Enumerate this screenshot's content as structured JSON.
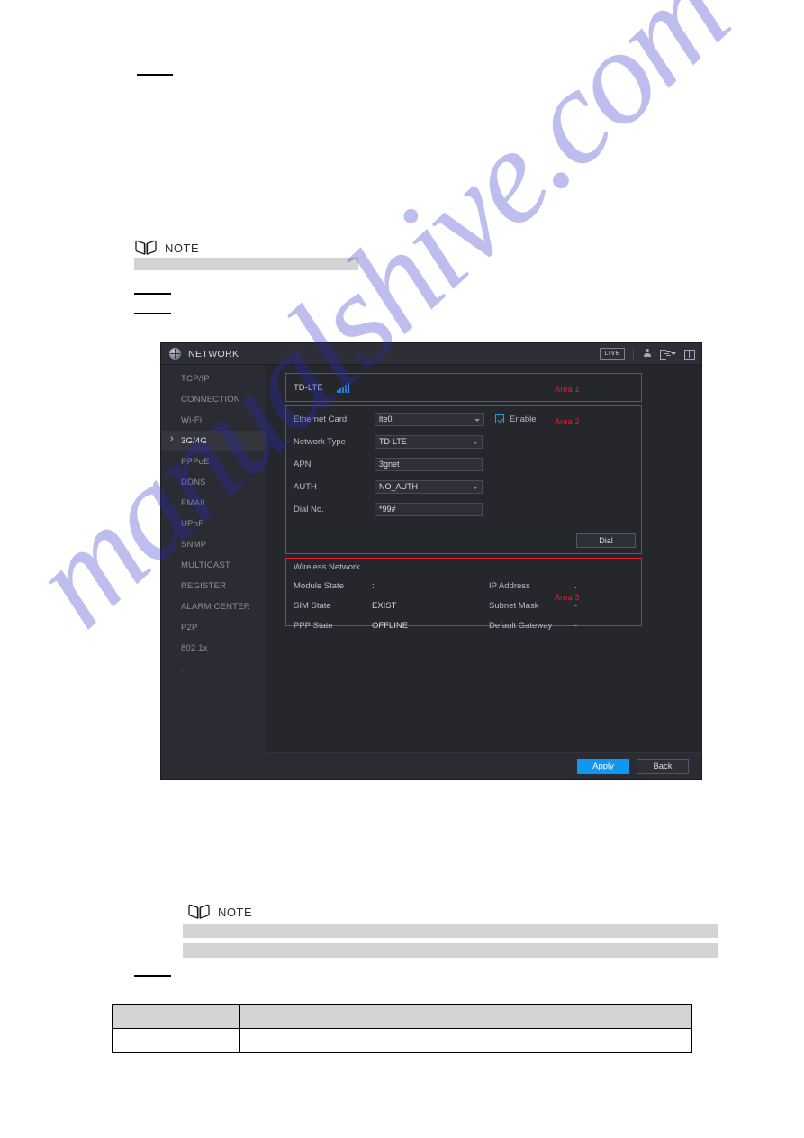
{
  "document": {
    "note_label": "NOTE",
    "redactions": {
      "top_rules": 1,
      "mid_rules": 2,
      "bottom_rules": 1
    }
  },
  "device": {
    "title": "NETWORK",
    "title_icon": "globe-icon",
    "status_icons": {
      "live_badge": "LIVE",
      "user_icon": "user-icon",
      "exit_icon": "exit-icon",
      "grid_icon": "grid-icon"
    },
    "sidebar": {
      "items": [
        {
          "label": "TCP/IP",
          "active": false
        },
        {
          "label": "CONNECTION",
          "active": false
        },
        {
          "label": "Wi-Fi",
          "active": false
        },
        {
          "label": "3G/4G",
          "active": true
        },
        {
          "label": "PPPoE",
          "active": false
        },
        {
          "label": "DDNS",
          "active": false
        },
        {
          "label": "EMAIL",
          "active": false
        },
        {
          "label": "UPnP",
          "active": false
        },
        {
          "label": "SNMP",
          "active": false
        },
        {
          "label": "MULTICAST",
          "active": false
        },
        {
          "label": "REGISTER",
          "active": false
        },
        {
          "label": "ALARM CENTER",
          "active": false
        },
        {
          "label": "P2P",
          "active": false
        },
        {
          "label": "802.1x",
          "active": false
        },
        {
          "label": ".",
          "active": false
        }
      ]
    },
    "area1": {
      "annotation": "Area 1",
      "network_name": "TD-LTE",
      "signal_icon": "signal-bars-icon",
      "signal_bars": 5
    },
    "area2": {
      "annotation": "Area 2",
      "fields": [
        {
          "label": "Ethernet Card",
          "value": "lte0",
          "type": "select"
        },
        {
          "label": "Network Type",
          "value": "TD-LTE",
          "type": "select"
        },
        {
          "label": "APN",
          "value": "3gnet",
          "type": "text"
        },
        {
          "label": "AUTH",
          "value": "NO_AUTH",
          "type": "select"
        },
        {
          "label": "Dial No.",
          "value": "*99#",
          "type": "text"
        }
      ],
      "enable_label": "Enable",
      "enable_checked": true,
      "dial_button": "Dial"
    },
    "area3": {
      "annotation": "Area 3",
      "title": "Wireless Network",
      "rows": [
        {
          "label_left": "Module State",
          "value_left": ":",
          "label_right": "IP Address",
          "value_right": "."
        },
        {
          "label_left": "SIM State",
          "value_left": "EXIST",
          "label_right": "Subnet Mask",
          "value_right": "-"
        },
        {
          "label_left": "PPP State",
          "value_left": "OFFLINE",
          "label_right": "Default Gateway",
          "value_right": "-"
        }
      ]
    },
    "footer": {
      "apply_label": "Apply",
      "back_label": "Back"
    }
  },
  "watermark": {
    "text": "manualshive.com",
    "color": "#2828c8"
  },
  "colors": {
    "accent_blue": "#1296f0",
    "annotation_red": "#ee1c25",
    "panel_bg": "#26272c",
    "sidebar_bg": "#2b2c33",
    "redaction_grey": "#d4d4d4"
  }
}
